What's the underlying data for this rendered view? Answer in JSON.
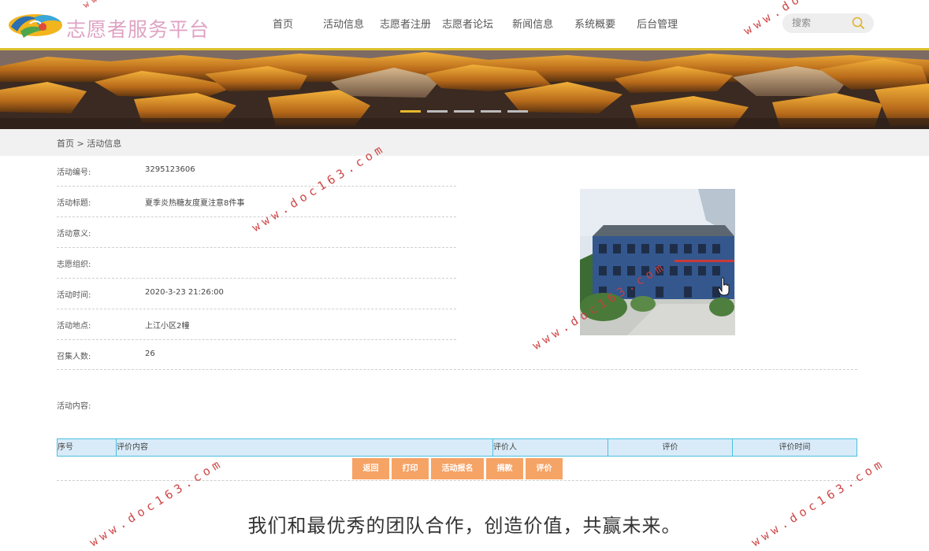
{
  "header": {
    "brand": "志愿者服务平台",
    "nav": [
      "首页",
      "活动信息",
      "志愿者注册",
      "志愿者论坛",
      "新闻信息",
      "系统概要",
      "后台管理"
    ],
    "search_placeholder": "搜索"
  },
  "banner": {
    "slide_count": 5,
    "active_slide": 1
  },
  "breadcrumb": {
    "home": "首页",
    "sep": ">",
    "current": "活动信息"
  },
  "activity": {
    "rows": [
      {
        "label": "活动编号:",
        "value": "3295123606"
      },
      {
        "label": "活动标题:",
        "value": "夏季炎热糖友度夏注意8件事"
      },
      {
        "label": "活动意义:",
        "value": ""
      },
      {
        "label": "志愿组织:",
        "value": ""
      },
      {
        "label": "活动时间:",
        "value": "2020-3-23 21:26:00"
      },
      {
        "label": "活动地点:",
        "value": "上江小区2幢"
      },
      {
        "label": "召集人数:",
        "value": "26"
      }
    ],
    "content_label": "活动内容:"
  },
  "review_table": {
    "headers": [
      "序号",
      "评价内容",
      "评价人",
      "评价",
      "评价时间"
    ]
  },
  "buttons": [
    "返回",
    "打印",
    "活动报名",
    "捐款",
    "评价"
  ],
  "slogan": "我们和最优秀的团队合作，创造价值，共赢未来。",
  "watermark": "www.doc163.com",
  "colors": {
    "accent": "#dcc02d",
    "button": "#f6a366",
    "table_border": "#49c1df",
    "table_bg": "#d9ebf9",
    "brand": "#e0a3c4",
    "watermark": "#cc3c3c"
  }
}
